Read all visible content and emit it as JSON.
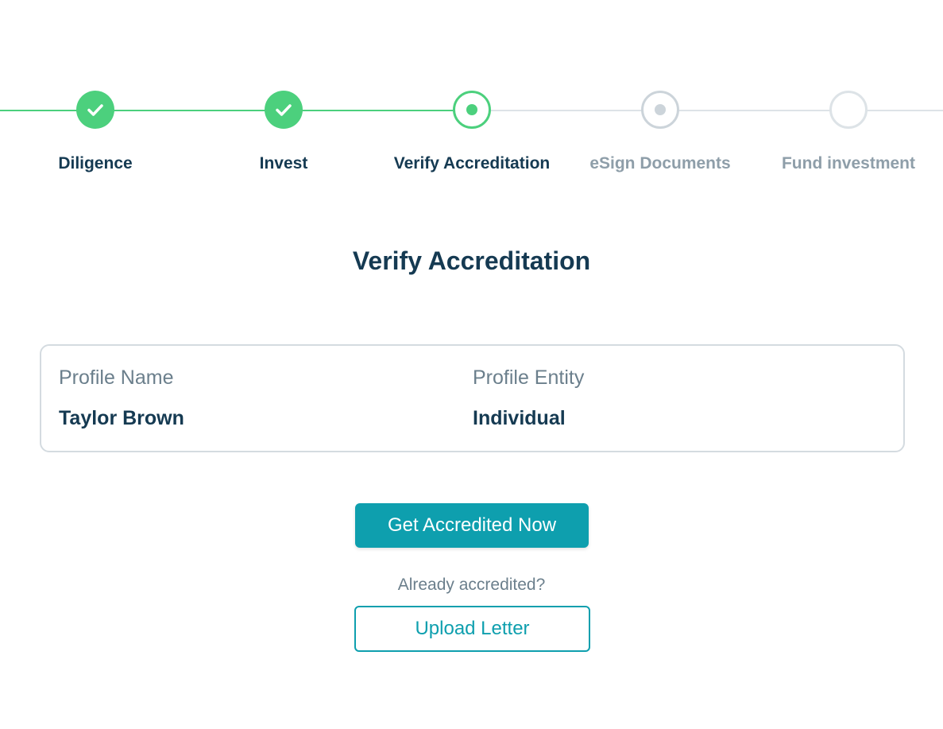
{
  "colors": {
    "complete": "#4cd07d",
    "pending": "#ccd4da",
    "future": "#dde3e7",
    "accent": "#0e9fae",
    "heading": "#153a52",
    "muted": "#8e9ea9"
  },
  "stepper": {
    "steps": [
      {
        "label": "Diligence",
        "status": "complete",
        "icon": "check-icon"
      },
      {
        "label": "Invest",
        "status": "complete",
        "icon": "check-icon"
      },
      {
        "label": "Verify Accreditation",
        "status": "current",
        "icon": "dot-icon"
      },
      {
        "label": "eSign Documents",
        "status": "pending",
        "icon": "dot-icon"
      },
      {
        "label": "Fund investment",
        "status": "not-started",
        "icon": "empty-circle-icon"
      }
    ]
  },
  "page": {
    "title": "Verify Accreditation"
  },
  "profile": {
    "name_label": "Profile Name",
    "name_value": "Taylor Brown",
    "entity_label": "Profile Entity",
    "entity_value": "Individual"
  },
  "actions": {
    "primary_label": "Get Accredited Now",
    "helper_text": "Already accredited?",
    "upload_label": "Upload Letter"
  }
}
